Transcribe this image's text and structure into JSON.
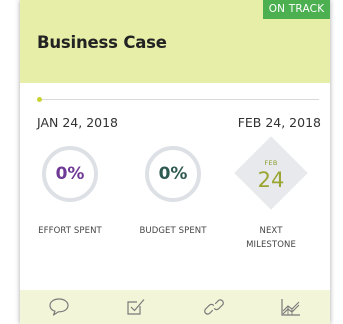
{
  "card": {
    "title": "Business Case",
    "status": "ON TRACK",
    "status_color": "#4caf50",
    "header_color": "#e6eea8"
  },
  "timeline": {
    "start_date": "JAN 24, 2018",
    "end_date": "FEB 24, 2018",
    "progress": 0
  },
  "metrics": {
    "effort": {
      "value": "0%",
      "label": "EFFORT SPENT"
    },
    "budget": {
      "value": "0%",
      "label": "BUDGET SPENT"
    }
  },
  "milestone": {
    "month": "FEB",
    "day": "24",
    "label_line1": "NEXT",
    "label_line2": "MILESTONE"
  },
  "footer": {
    "icons": [
      "comment-icon",
      "checkbox-icon",
      "link-icon",
      "chart-icon"
    ]
  }
}
